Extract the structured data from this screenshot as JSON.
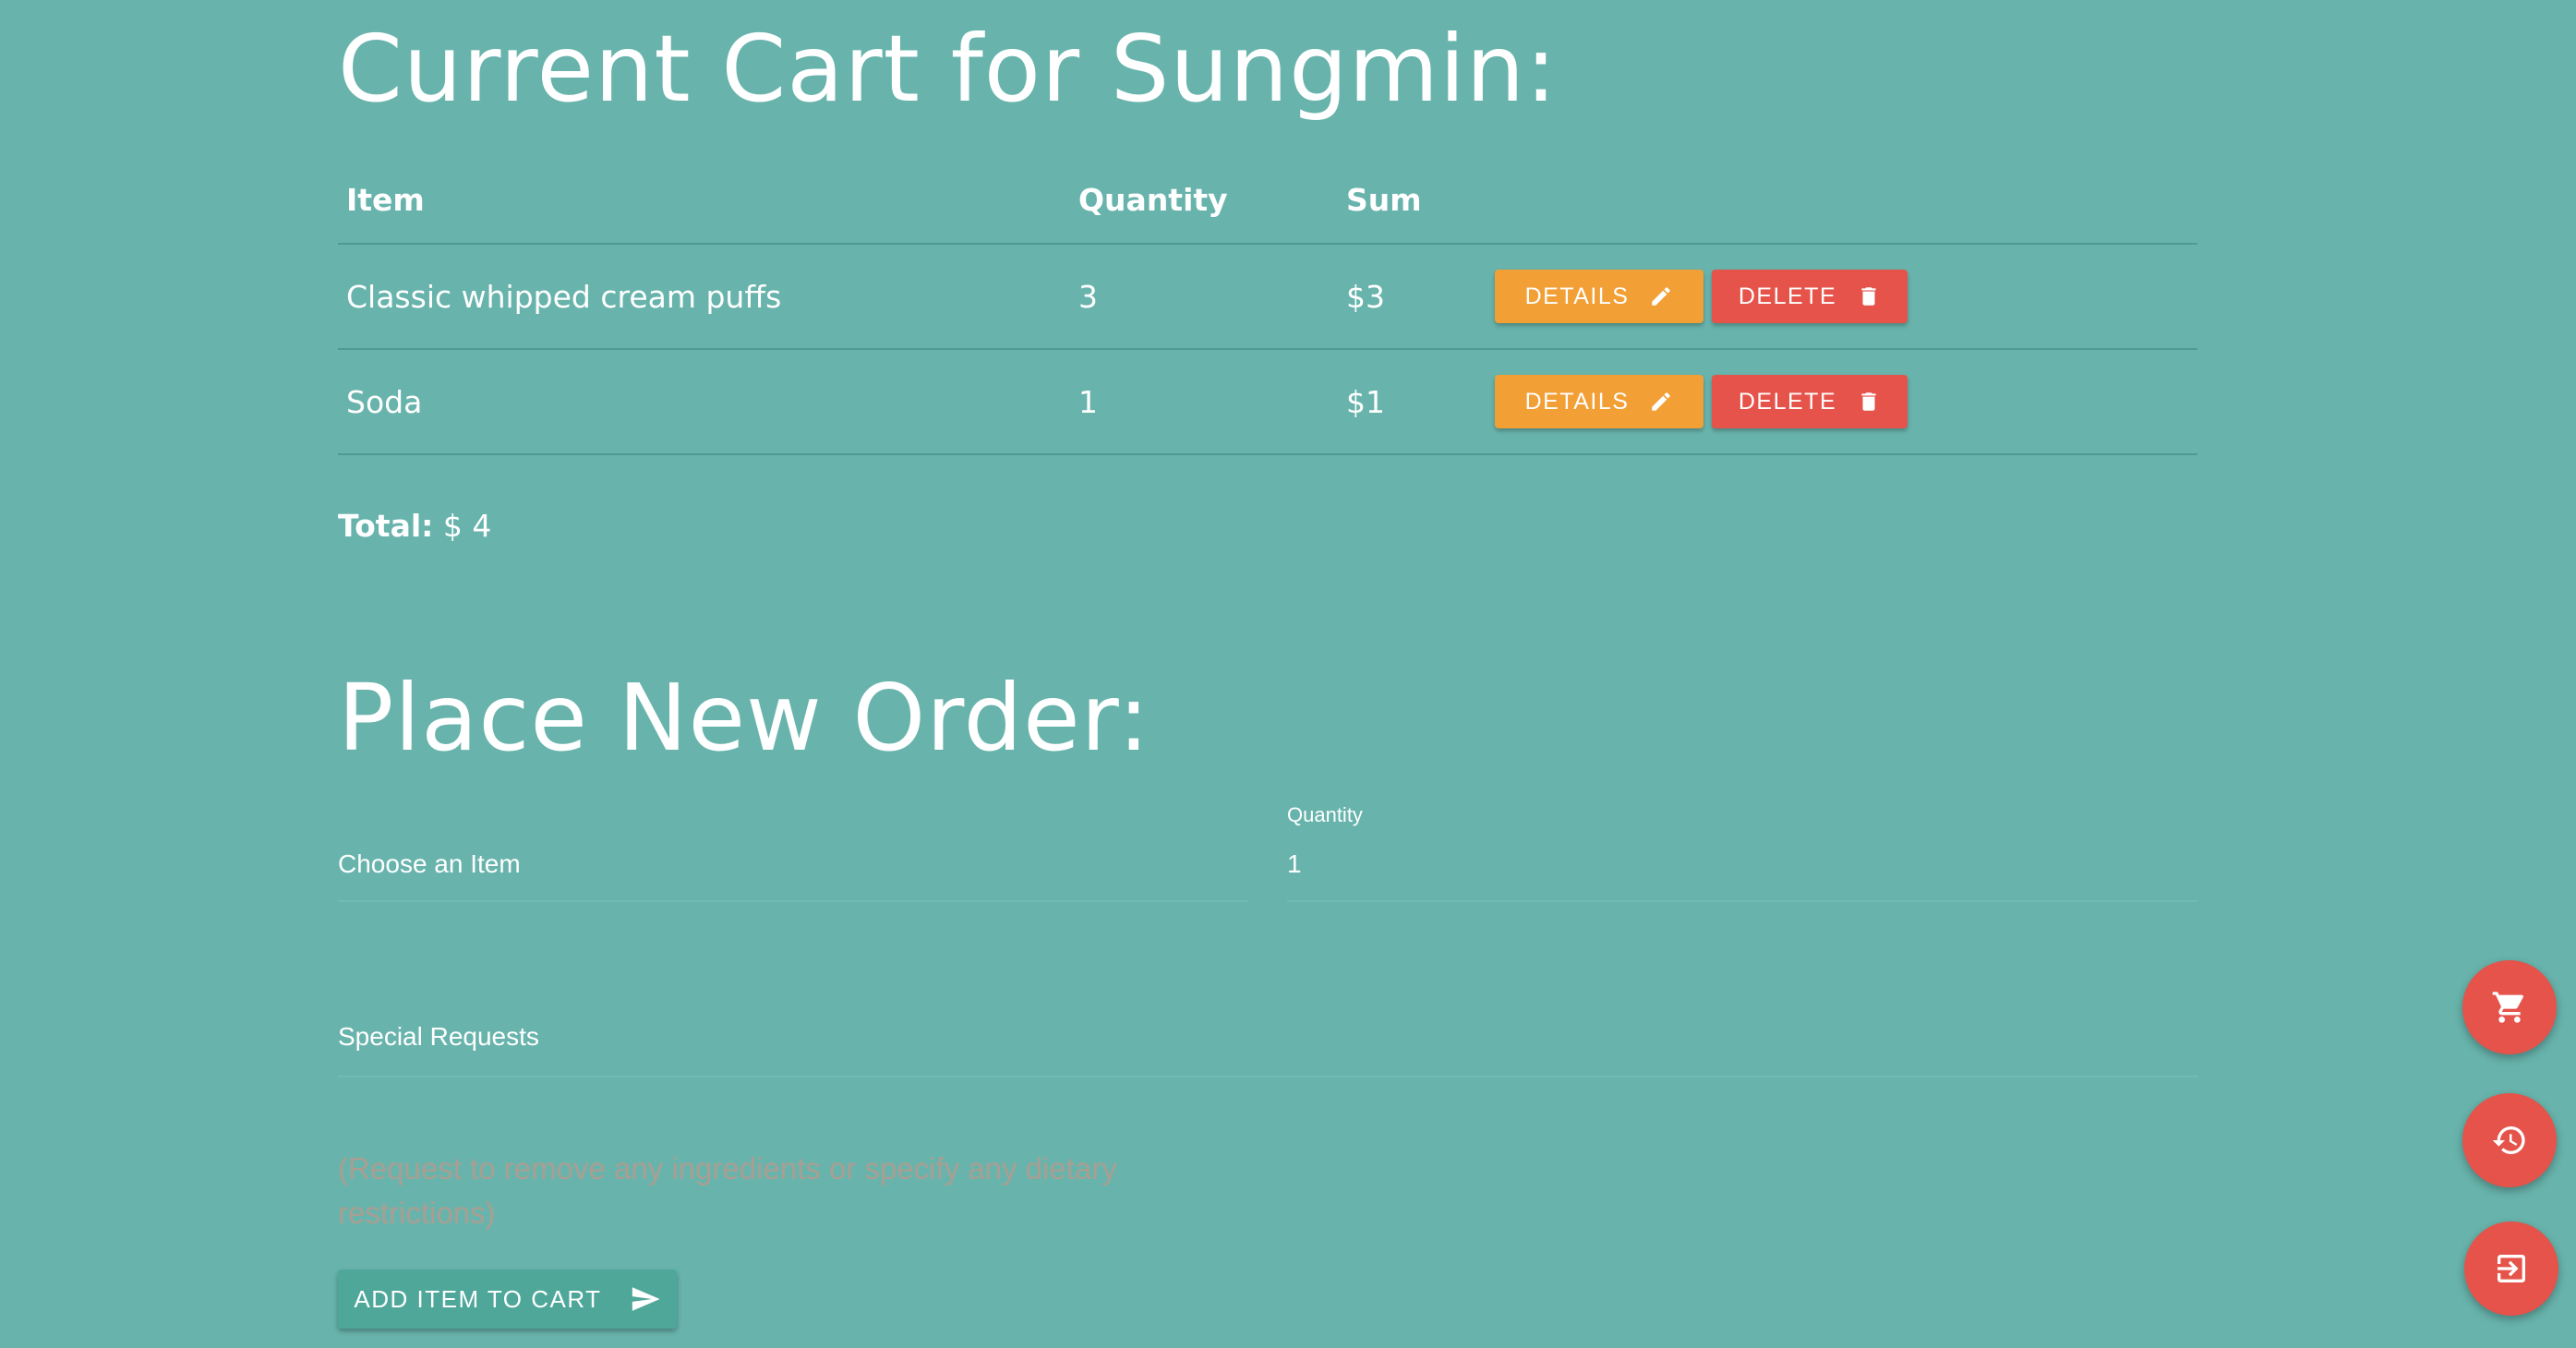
{
  "cart": {
    "title": "Current Cart for Sungmin:",
    "columns": {
      "item": "Item",
      "quantity": "Quantity",
      "sum": "Sum"
    },
    "rows": [
      {
        "item": "Classic whipped cream puffs",
        "quantity": "3",
        "sum": "$3",
        "details_label": "DETAILS",
        "delete_label": "DELETE"
      },
      {
        "item": "Soda",
        "quantity": "1",
        "sum": "$1",
        "details_label": "DETAILS",
        "delete_label": "DELETE"
      }
    ],
    "total_label": "Total:",
    "total_value": "$ 4"
  },
  "order": {
    "title": "Place New Order:",
    "item_select_label": "Choose an Item",
    "quantity_label": "Quantity",
    "quantity_value": "1",
    "special_requests_label": "Special Requests",
    "special_requests_placeholder": "(Request to remove any ingredients or specify any dietary restrictions)",
    "add_button_label": "ADD ITEM TO CART"
  },
  "fabs": {
    "cart_icon": "cart-icon",
    "history_icon": "history-icon",
    "logout_icon": "exit-icon"
  },
  "colors": {
    "background": "#68b4ac",
    "details_button": "#f29f36",
    "delete_button": "#e5534a",
    "add_button": "#4fa79a",
    "fab": "#e5534a"
  }
}
